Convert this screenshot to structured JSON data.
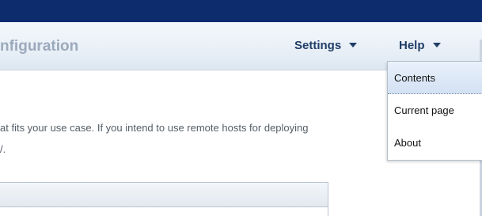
{
  "header": {
    "title": "nfiguration",
    "settings_label": "Settings",
    "help_label": "Help"
  },
  "content": {
    "intro_line1": "at fits your use case. If you intend to use remote hosts for deploying",
    "intro_line2": "/."
  },
  "help_menu": {
    "items": [
      {
        "label": "Contents",
        "active": true
      },
      {
        "label": "Current page",
        "active": false
      },
      {
        "label": "About",
        "active": false
      }
    ]
  },
  "colors": {
    "top_bar": "#0d2c6e",
    "menu_text": "#1f3d66",
    "title_text": "#9ba9bb"
  },
  "icons": {
    "settings_chevron": "chevron-down-icon",
    "help_chevron": "chevron-down-icon"
  }
}
